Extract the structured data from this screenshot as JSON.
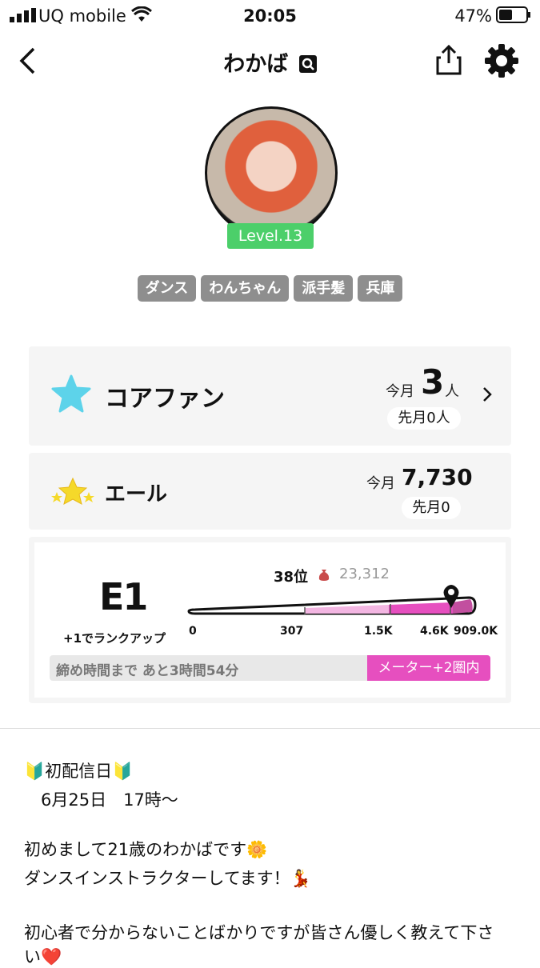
{
  "status_bar": {
    "carrier": "UQ mobile",
    "time": "20:05",
    "battery": "47%"
  },
  "header": {
    "title": "わかば"
  },
  "profile": {
    "level": "Level.13",
    "tags": [
      "ダンス",
      "わんちゃん",
      "派手髪",
      "兵庫"
    ]
  },
  "core_fan": {
    "label": "コアファン",
    "this_month_label": "今月",
    "count": "3",
    "unit": "人",
    "last_month": "先月0人"
  },
  "yell": {
    "label": "エール",
    "this_month_label": "今月",
    "count": "7,730",
    "last_month": "先月0"
  },
  "rank": {
    "grade": "E1",
    "rank_up_text": "+1でランクアップ",
    "position": "38位",
    "score": "23,312",
    "ticks": [
      "0",
      "307",
      "1.5K",
      "4.6K",
      "909.0K"
    ],
    "timer_text": "締め時間まで あと3時間54分",
    "meter_text": "メーター+2圏内",
    "colors": {
      "fill": "#e64fbf",
      "fill_light": "#f3b6e2",
      "fill_dark": "#c24f9f"
    }
  },
  "bio": {
    "lines": [
      "🔰初配信日🔰",
      "　6月25日　17時〜",
      "",
      "初めまして21歳のわかばです🌼",
      "ダンスインストラクターしてます！💃",
      "",
      "初心者で分からないことばかりですが皆さん優しく教えて下さ",
      "い❤️"
    ]
  }
}
